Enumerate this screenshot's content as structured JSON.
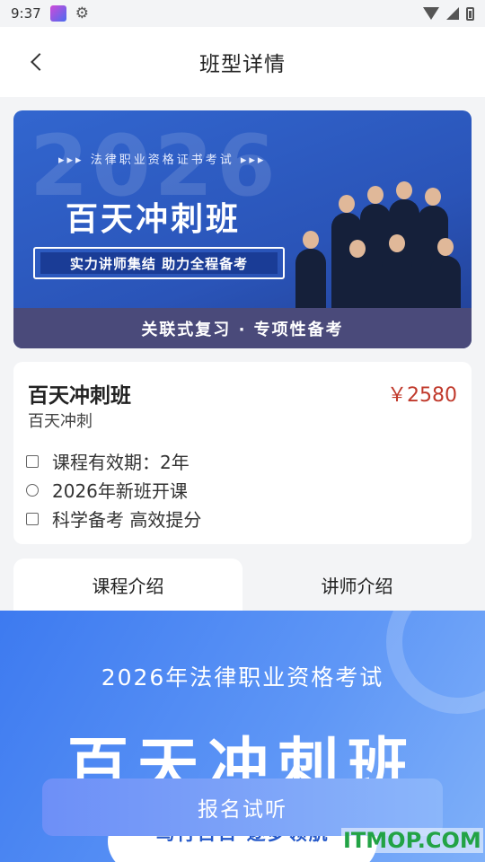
{
  "status_bar": {
    "time": "9:37"
  },
  "header": {
    "title": "班型详情"
  },
  "banner": {
    "year": "2026",
    "subtitle": "▸▸▸ 法律职业资格证书考试 ▸▸▸",
    "title": "百天冲刺班",
    "tagline": "实力讲师集结 助力全程备考",
    "footer": "关联式复习 · 专项性备考"
  },
  "course": {
    "name": "百天冲刺班",
    "price": "￥2580",
    "subtitle": "百天冲刺",
    "features": [
      {
        "icon": "calendar-icon",
        "text": "课程有效期：2年"
      },
      {
        "icon": "clock-icon",
        "text": "2026年新班开课"
      },
      {
        "icon": "book-icon",
        "text": "科学备考 高效提分"
      }
    ]
  },
  "tabs": [
    {
      "label": "课程介绍",
      "active": true
    },
    {
      "label": "讲师介绍",
      "active": false
    }
  ],
  "promo": {
    "title": "2026年法律职业资格考试",
    "headline": "百天冲刺班",
    "pill": "笃行百日 逐梦领航"
  },
  "signup": {
    "label": "报名试听"
  },
  "watermark": "ITMOP.COM"
}
